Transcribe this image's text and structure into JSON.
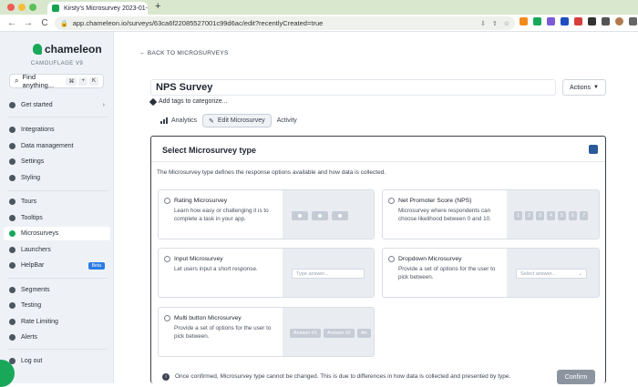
{
  "browser": {
    "tab_title": "Kirsty's Microsurvey 2023-01-",
    "tab_close": "×",
    "new_tab": "+",
    "url": "app.chameleon.io/surveys/63ca6f22085527001c99d6ac/edit?recentlyCreated=true",
    "nav_back": "←",
    "nav_forward": "→",
    "nav_reload": "C"
  },
  "sidebar": {
    "logo": "chameleon",
    "subtitle": "CAMOUFLAGE V9",
    "find_label": "Find anything...",
    "find_shortcut": [
      "⌘",
      "+",
      "K"
    ],
    "items": [
      {
        "label": "Get started",
        "icon": "rocket-icon"
      },
      {
        "label": "Integrations",
        "icon": "plug-icon"
      },
      {
        "label": "Data management",
        "icon": "database-icon"
      },
      {
        "label": "Settings",
        "icon": "gear-icon"
      },
      {
        "label": "Styling",
        "icon": "palette-icon"
      },
      {
        "label": "Tours",
        "icon": "tour-icon"
      },
      {
        "label": "Tooltips",
        "icon": "tooltip-icon"
      },
      {
        "label": "Microsurveys",
        "icon": "star-icon"
      },
      {
        "label": "Launchers",
        "icon": "rocket-icon"
      },
      {
        "label": "HelpBar",
        "icon": "help-icon",
        "badge": "Beta"
      },
      {
        "label": "Segments",
        "icon": "segments-icon"
      },
      {
        "label": "Testing",
        "icon": "testing-icon"
      },
      {
        "label": "Rate Limiting",
        "icon": "rate-limit-icon"
      },
      {
        "label": "Alerts",
        "icon": "bell-icon"
      },
      {
        "label": "Log out",
        "icon": "logout-icon"
      }
    ],
    "chevron": "›"
  },
  "main": {
    "back_link": "BACK TO MICROSURVEYS",
    "title_value": "NPS Survey",
    "actions_label": "Actions",
    "add_tags": "Add tags to categorize...",
    "tabs": [
      {
        "label": "Analytics"
      },
      {
        "label": "Edit Microsurvey"
      },
      {
        "label": "Activity"
      }
    ]
  },
  "panel": {
    "title": "Select Microsurvey type",
    "description": "The Microsurvey type defines the response options available and how data is collected.",
    "types": [
      {
        "name": "Rating Microsurvey",
        "desc": "Learn how easy or challenging it is to complete a task in your app."
      },
      {
        "name": "Net Promoter Score (NPS)",
        "desc": "Microsurvey where respondents can choose likelihood between 0 and 10.",
        "scale": [
          "1",
          "2",
          "3",
          "4",
          "5",
          "6",
          "7"
        ]
      },
      {
        "name": "Input Microsurvey",
        "desc": "Let users input a short response.",
        "placeholder": "Type answer..."
      },
      {
        "name": "Dropdown Microsurvey",
        "desc": "Provide a set of options for the user to pick between.",
        "placeholder": "Select answer..."
      },
      {
        "name": "Multi button Microsurvey",
        "desc": "Provide a set of options for the user to pick between.",
        "buttons": [
          "Answer #1",
          "Answer #2",
          "An"
        ]
      }
    ],
    "footer_note": "Once confirmed, Microsurvey type cannot be changed. This is due to differences in how data is collected and presented by type.",
    "confirm_label": "Confirm"
  },
  "colors": {
    "brand": "#19a85a",
    "tab_bar": "#d8e7ce",
    "sidebar_bg": "#eef2f6",
    "beta_badge": "#2c7be5"
  }
}
